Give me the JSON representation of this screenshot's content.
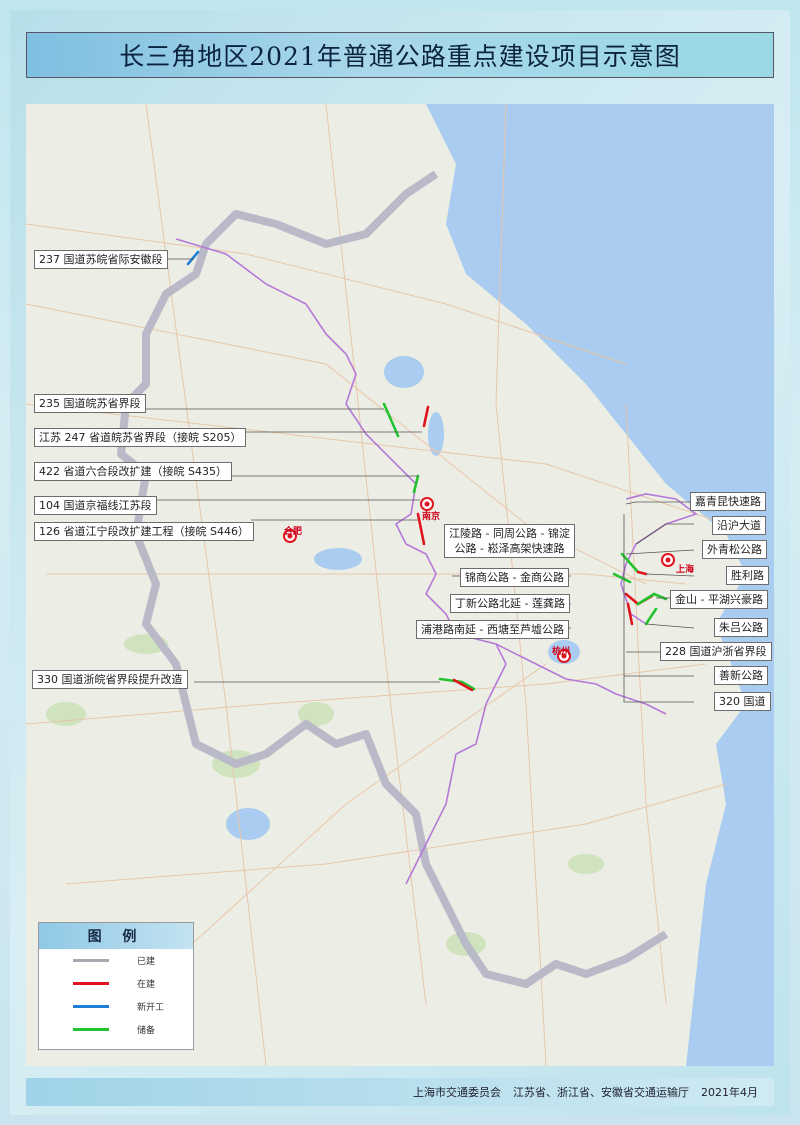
{
  "title": "长三角地区2021年普通公路重点建设项目示意图",
  "cities": [
    {
      "name": "南京"
    },
    {
      "name": "合肥"
    },
    {
      "name": "上海"
    },
    {
      "name": "杭州"
    }
  ],
  "project_labels": [
    "237 国道苏皖省际安徽段",
    "235 国道皖苏省界段",
    "江苏 247 省道皖苏省界段（接皖 S205）",
    "422 省道六合段改扩建（接皖 S435）",
    "104 国道京福线江苏段",
    "126 省道江宁段改扩建工程（接皖 S446）",
    "江陵路 - 同周公路 - 锦淀\n公路 - 崧泽高架快速路",
    "锦商公路 - 金商公路",
    "丁新公路北延 - 莲龚路",
    "浦港路南延 - 西塘至芦墟公路",
    "330 国道浙皖省界段提升改造",
    "嘉青昆快速路",
    "沿沪大道",
    "外青松公路",
    "胜利路",
    "金山 - 平湖兴豪路",
    "朱吕公路",
    "228 国道沪浙省界段",
    "善新公路",
    "320 国道"
  ],
  "legend": {
    "title": "图  例",
    "items": [
      {
        "label": "已建",
        "color": "#a8a8b0"
      },
      {
        "label": "在建",
        "color": "#e0141e"
      },
      {
        "label": "新开工",
        "color": "#1f7fd6"
      },
      {
        "label": "储备",
        "color": "#22c32e"
      }
    ]
  },
  "colors": {
    "sea": "#a9ccf0",
    "land": "#eceee6",
    "boundary": "#b9b9c8",
    "province_line": "#b678d8"
  },
  "footer": {
    "org1": "上海市交通委员会",
    "org2": "江苏省、浙江省、安徽省交通运输厅",
    "date": "2021年4月"
  }
}
